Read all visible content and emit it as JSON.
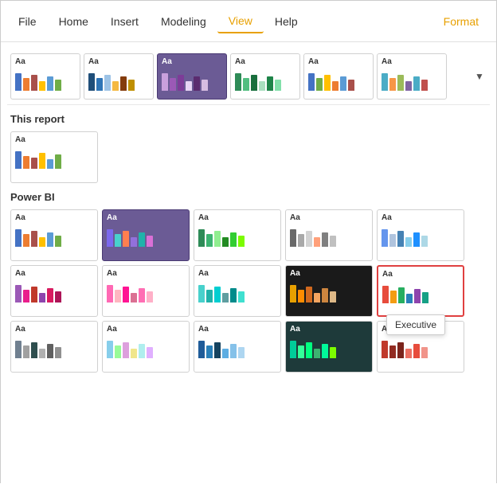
{
  "menubar": {
    "items": [
      {
        "label": "File",
        "active": false
      },
      {
        "label": "Home",
        "active": false
      },
      {
        "label": "Insert",
        "active": false
      },
      {
        "label": "Modeling",
        "active": false
      },
      {
        "label": "View",
        "active": true
      },
      {
        "label": "Help",
        "active": false
      },
      {
        "label": "Format",
        "active": false,
        "accent": true
      }
    ]
  },
  "sections": {
    "this_report": "This report",
    "power_bi": "Power BI"
  },
  "tooltip": "Executive",
  "ribbon_themes": [
    {
      "label": "Aa",
      "bars": [
        {
          "color": "#4472C4",
          "height": 22
        },
        {
          "color": "#ED7D31",
          "height": 16
        },
        {
          "color": "#A9504B",
          "height": 20
        },
        {
          "color": "#FFC000",
          "height": 12
        },
        {
          "color": "#5B9BD5",
          "height": 18
        },
        {
          "color": "#70AD47",
          "height": 14
        }
      ],
      "bg": "#fff"
    },
    {
      "label": "Aa",
      "bars": [
        {
          "color": "#1F4E79",
          "height": 22
        },
        {
          "color": "#2F75B6",
          "height": 16
        },
        {
          "color": "#9DC3E6",
          "height": 20
        },
        {
          "color": "#F4B942",
          "height": 12
        },
        {
          "color": "#843C0C",
          "height": 18
        },
        {
          "color": "#BF8F00",
          "height": 14
        }
      ],
      "bg": "#fff"
    },
    {
      "label": "Aa",
      "bars": [
        {
          "color": "#C9A0DC",
          "height": 22
        },
        {
          "color": "#9B59B6",
          "height": 16
        },
        {
          "color": "#7D3C98",
          "height": 20
        },
        {
          "color": "#E8D5F5",
          "height": 12
        },
        {
          "color": "#5B2C6F",
          "height": 18
        },
        {
          "color": "#D7BDE2",
          "height": 14
        }
      ],
      "bg": "#6b5b95",
      "selected": "purple"
    },
    {
      "label": "Aa",
      "bars": [
        {
          "color": "#2E8B57",
          "height": 22
        },
        {
          "color": "#52BE80",
          "height": 16
        },
        {
          "color": "#196F3D",
          "height": 20
        },
        {
          "color": "#A9DFBF",
          "height": 12
        },
        {
          "color": "#1E8449",
          "height": 18
        },
        {
          "color": "#82E0AA",
          "height": 14
        }
      ],
      "bg": "#fff"
    },
    {
      "label": "Aa",
      "bars": [
        {
          "color": "#4472C4",
          "height": 22
        },
        {
          "color": "#70AD47",
          "height": 16
        },
        {
          "color": "#FFC000",
          "height": 20
        },
        {
          "color": "#ED7D31",
          "height": 12
        },
        {
          "color": "#5B9BD5",
          "height": 18
        },
        {
          "color": "#A9504B",
          "height": 14
        }
      ],
      "bg": "#fff"
    },
    {
      "label": "Aa",
      "bars": [
        {
          "color": "#4BACC6",
          "height": 22
        },
        {
          "color": "#F79646",
          "height": 16
        },
        {
          "color": "#9BBB59",
          "height": 20
        },
        {
          "color": "#8064A2",
          "height": 12
        },
        {
          "color": "#4BACC6",
          "height": 18
        },
        {
          "color": "#C0504D",
          "height": 14
        }
      ],
      "bg": "#fff"
    }
  ],
  "this_report_theme": {
    "label": "Aa",
    "bars": [
      {
        "color": "#4472C4",
        "height": 22
      },
      {
        "color": "#ED7D31",
        "height": 16
      },
      {
        "color": "#A9504B",
        "height": 14
      },
      {
        "color": "#FFC000",
        "height": 20
      },
      {
        "color": "#5B9BD5",
        "height": 12
      },
      {
        "color": "#70AD47",
        "height": 18
      }
    ]
  },
  "power_bi_themes": [
    {
      "label": "Aa",
      "bars": [
        {
          "color": "#4472C4",
          "height": 22
        },
        {
          "color": "#ED7D31",
          "height": 16
        },
        {
          "color": "#A9504B",
          "height": 20
        },
        {
          "color": "#FFC000",
          "height": 12
        },
        {
          "color": "#5B9BD5",
          "height": 18
        },
        {
          "color": "#70AD47",
          "height": 14
        }
      ],
      "bg": "#fff"
    },
    {
      "label": "Aa",
      "bars": [
        {
          "color": "#7B68EE",
          "height": 22
        },
        {
          "color": "#48D1CC",
          "height": 16
        },
        {
          "color": "#FF7F50",
          "height": 20
        },
        {
          "color": "#9370DB",
          "height": 12
        },
        {
          "color": "#20B2AA",
          "height": 18
        },
        {
          "color": "#DA70D6",
          "height": 14
        }
      ],
      "bg": "#6b5b95"
    },
    {
      "label": "Aa",
      "bars": [
        {
          "color": "#2E8B57",
          "height": 22
        },
        {
          "color": "#3CB371",
          "height": 16
        },
        {
          "color": "#90EE90",
          "height": 20
        },
        {
          "color": "#228B22",
          "height": 12
        },
        {
          "color": "#32CD32",
          "height": 18
        },
        {
          "color": "#7CFC00",
          "height": 14
        }
      ],
      "bg": "#fff"
    },
    {
      "label": "Aa",
      "bars": [
        {
          "color": "#696969",
          "height": 22
        },
        {
          "color": "#A9A9A9",
          "height": 16
        },
        {
          "color": "#D3D3D3",
          "height": 20
        },
        {
          "color": "#FFA07A",
          "height": 12
        },
        {
          "color": "#808080",
          "height": 18
        },
        {
          "color": "#C0C0C0",
          "height": 14
        }
      ],
      "bg": "#fff"
    },
    {
      "label": "Aa",
      "bars": [
        {
          "color": "#6495ED",
          "height": 22
        },
        {
          "color": "#B0C4DE",
          "height": 16
        },
        {
          "color": "#4682B4",
          "height": 20
        },
        {
          "color": "#87CEEB",
          "height": 12
        },
        {
          "color": "#1E90FF",
          "height": 18
        },
        {
          "color": "#ADD8E6",
          "height": 14
        }
      ],
      "bg": "#fff"
    },
    {
      "label": "Aa",
      "bars": [
        {
          "color": "#9B59B6",
          "height": 22
        },
        {
          "color": "#E91E8C",
          "height": 16
        },
        {
          "color": "#C0392B",
          "height": 20
        },
        {
          "color": "#8E44AD",
          "height": 12
        },
        {
          "color": "#D81B60",
          "height": 18
        },
        {
          "color": "#AD1457",
          "height": 14
        }
      ],
      "bg": "#fff"
    },
    {
      "label": "Aa",
      "bars": [
        {
          "color": "#FF69B4",
          "height": 22
        },
        {
          "color": "#FFB6C1",
          "height": 16
        },
        {
          "color": "#FF1493",
          "height": 20
        },
        {
          "color": "#DB7093",
          "height": 12
        },
        {
          "color": "#FF6EB4",
          "height": 18
        },
        {
          "color": "#FFB0C8",
          "height": 14
        }
      ],
      "bg": "#fff"
    },
    {
      "label": "Aa",
      "bars": [
        {
          "color": "#48D1CC",
          "height": 22
        },
        {
          "color": "#20B2AA",
          "height": 16
        },
        {
          "color": "#00CED1",
          "height": 20
        },
        {
          "color": "#5F9EA0",
          "height": 12
        },
        {
          "color": "#008B8B",
          "height": 18
        },
        {
          "color": "#40E0D0",
          "height": 14
        }
      ],
      "bg": "#fff"
    },
    {
      "label": "Aa",
      "bars": [
        {
          "color": "#E8A000",
          "height": 22
        },
        {
          "color": "#FF8C00",
          "height": 16
        },
        {
          "color": "#D2691E",
          "height": 20
        },
        {
          "color": "#F4A460",
          "height": 12
        },
        {
          "color": "#CD853F",
          "height": 18
        },
        {
          "color": "#DEB887",
          "height": 14
        }
      ],
      "bg": "#1a1a1a",
      "dark": true
    },
    {
      "label": "Aa",
      "bars": [
        {
          "color": "#E74C3C",
          "height": 22
        },
        {
          "color": "#F39C12",
          "height": 16
        },
        {
          "color": "#27AE60",
          "height": 20
        },
        {
          "color": "#2980B9",
          "height": 12
        },
        {
          "color": "#8E44AD",
          "height": 18
        },
        {
          "color": "#16A085",
          "height": 14
        }
      ],
      "bg": "#fff",
      "selected_red": true,
      "tooltip": true
    },
    {
      "label": "Aa",
      "bars": [
        {
          "color": "#708090",
          "height": 22
        },
        {
          "color": "#A0A0A0",
          "height": 16
        },
        {
          "color": "#2F4F4F",
          "height": 20
        },
        {
          "color": "#B0B0B0",
          "height": 12
        },
        {
          "color": "#606060",
          "height": 18
        },
        {
          "color": "#909090",
          "height": 14
        }
      ],
      "bg": "#fff"
    },
    {
      "label": "Aa",
      "bars": [
        {
          "color": "#87CEEB",
          "height": 22
        },
        {
          "color": "#98FB98",
          "height": 16
        },
        {
          "color": "#DDA0DD",
          "height": 20
        },
        {
          "color": "#F0E68C",
          "height": 12
        },
        {
          "color": "#AFEEEE",
          "height": 18
        },
        {
          "color": "#E0B0FF",
          "height": 14
        }
      ],
      "bg": "#fff"
    },
    {
      "label": "Aa",
      "bars": [
        {
          "color": "#1F5C99",
          "height": 22
        },
        {
          "color": "#2980B9",
          "height": 16
        },
        {
          "color": "#154360",
          "height": 20
        },
        {
          "color": "#5DADE2",
          "height": 12
        },
        {
          "color": "#85C1E9",
          "height": 18
        },
        {
          "color": "#AED6F1",
          "height": 14
        }
      ],
      "bg": "#fff"
    },
    {
      "label": "Aa",
      "bars": [
        {
          "color": "#00CC99",
          "height": 22
        },
        {
          "color": "#33FF99",
          "height": 16
        },
        {
          "color": "#00FF7F",
          "height": 20
        },
        {
          "color": "#3CB371",
          "height": 12
        },
        {
          "color": "#00FA9A",
          "height": 18
        },
        {
          "color": "#7CFC00",
          "height": 14
        }
      ],
      "bg": "#1e3a3a",
      "teal": true
    },
    {
      "label": "Aa",
      "bars": [
        {
          "color": "#C0392B",
          "height": 22
        },
        {
          "color": "#922B21",
          "height": 16
        },
        {
          "color": "#7B241C",
          "height": 20
        },
        {
          "color": "#EC7063",
          "height": 12
        },
        {
          "color": "#E74C3C",
          "height": 18
        },
        {
          "color": "#F1948A",
          "height": 14
        }
      ],
      "bg": "#fff"
    }
  ]
}
